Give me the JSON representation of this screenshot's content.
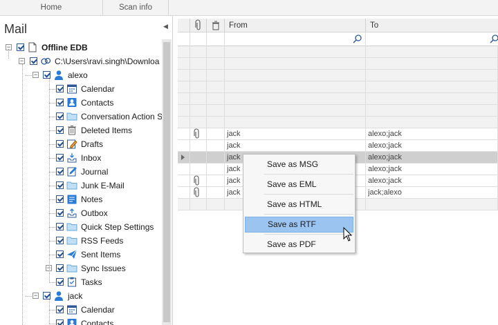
{
  "ribbon": {
    "tabs": [
      {
        "label": "Home"
      },
      {
        "label": "Scan info"
      }
    ]
  },
  "sidebar": {
    "title": "Mail",
    "tree": {
      "root": "Offline EDB",
      "path": "C:\\Users\\ravi.singh\\Downloa",
      "mailboxes": [
        {
          "name": "alexo",
          "folders": [
            {
              "label": "Calendar",
              "icon": "calendar-icon"
            },
            {
              "label": "Contacts",
              "icon": "contacts-icon"
            },
            {
              "label": "Conversation Action S",
              "icon": "folder-icon"
            },
            {
              "label": "Deleted Items",
              "icon": "trash-icon"
            },
            {
              "label": "Drafts",
              "icon": "drafts-icon"
            },
            {
              "label": "Inbox",
              "icon": "inbox-icon"
            },
            {
              "label": "Journal",
              "icon": "journal-icon"
            },
            {
              "label": "Junk E-Mail",
              "icon": "folder-icon"
            },
            {
              "label": "Notes",
              "icon": "notes-icon"
            },
            {
              "label": "Outbox",
              "icon": "outbox-icon"
            },
            {
              "label": "Quick Step Settings",
              "icon": "folder-icon"
            },
            {
              "label": "RSS Feeds",
              "icon": "folder-icon"
            },
            {
              "label": "Sent Items",
              "icon": "sent-icon"
            },
            {
              "label": "Sync Issues",
              "icon": "folder-icon"
            },
            {
              "label": "Tasks",
              "icon": "tasks-icon"
            }
          ]
        },
        {
          "name": "jack",
          "folders": [
            {
              "label": "Calendar",
              "icon": "calendar-icon"
            },
            {
              "label": "Contacts",
              "icon": "contacts-icon"
            }
          ]
        }
      ]
    }
  },
  "grid": {
    "columns": [
      {
        "label": "",
        "icon": "attachment-icon"
      },
      {
        "label": "",
        "icon": "trash-icon"
      },
      {
        "label": "From"
      },
      {
        "label": "To"
      }
    ],
    "rows": [
      {
        "attach": false,
        "from": "",
        "to": ""
      },
      {
        "attach": false,
        "from": "",
        "to": ""
      },
      {
        "attach": false,
        "from": "",
        "to": ""
      },
      {
        "attach": false,
        "from": "",
        "to": ""
      },
      {
        "attach": false,
        "from": "",
        "to": ""
      },
      {
        "attach": false,
        "from": "",
        "to": ""
      },
      {
        "attach": false,
        "from": "",
        "to": ""
      },
      {
        "attach": true,
        "from": "jack",
        "to": "alexo;jack"
      },
      {
        "attach": false,
        "from": "jack",
        "to": "alexo;jack"
      },
      {
        "attach": false,
        "from": "jack",
        "to": "alexo;jack",
        "selected": true
      },
      {
        "attach": false,
        "from": "jack",
        "to": "alexo;jack"
      },
      {
        "attach": true,
        "from": "jack",
        "to": "alexo;jack"
      },
      {
        "attach": true,
        "from": "jack",
        "to": "jack;alexo"
      },
      {
        "attach": false,
        "from": "",
        "to": ""
      }
    ]
  },
  "context_menu": {
    "items": [
      {
        "label": "Save as MSG"
      },
      {
        "label": "Save as EML"
      },
      {
        "label": "Save as HTML"
      },
      {
        "label": "Save as RTF",
        "highlighted": true
      },
      {
        "label": "Save as PDF"
      }
    ]
  },
  "colors": {
    "accent": "#1e4e8c",
    "highlight": "#9bc4f0",
    "selected_row": "#cfcfcf"
  }
}
